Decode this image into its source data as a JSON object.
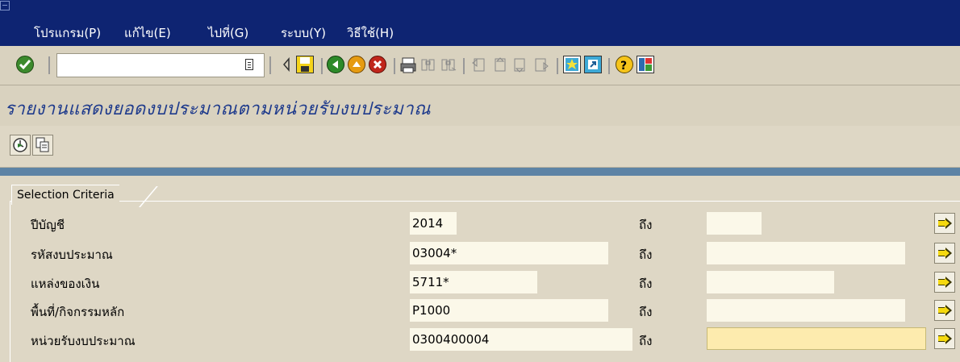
{
  "menu": {
    "items": [
      {
        "label": "โปรแกรม(P)"
      },
      {
        "label": "แก้ไข(E)"
      },
      {
        "label": "ไปที่(G)"
      },
      {
        "label": "ระบบ(Y)"
      },
      {
        "label": "วิธีใช้(H)"
      }
    ]
  },
  "toolbar": {
    "command_field_value": "",
    "icons": [
      "enter-check-icon",
      "back-triangle-icon",
      "save-icon",
      "back-icon",
      "exit-icon",
      "cancel-icon",
      "print-icon",
      "find-icon",
      "find-next-icon",
      "first-page-icon",
      "previous-page-icon",
      "next-page-icon",
      "last-page-icon",
      "create-session-icon",
      "create-shortcut-icon",
      "help-icon",
      "customize-layout-icon"
    ]
  },
  "page": {
    "title": "รายงานแสดงยอดงบประมาณตามหน่วยรับงบประมาณ"
  },
  "app_toolbar": {
    "icons": [
      "execute-icon",
      "get-variant-icon"
    ]
  },
  "selection": {
    "section_title": "Selection Criteria",
    "to_label": "ถึง",
    "rows": [
      {
        "label": "ปีบัญชี",
        "from": "2014",
        "to": ""
      },
      {
        "label": "รหัสงบประมาณ",
        "from": "03004*",
        "to": ""
      },
      {
        "label": "แหล่งของเงิน",
        "from": "5711*",
        "to": ""
      },
      {
        "label": "พื้นที่/กิจกรรมหลัก",
        "from": "P1000",
        "to": ""
      },
      {
        "label": "หน่วยรับงบประมาณ",
        "from": "0300400004",
        "to": ""
      }
    ]
  },
  "colors": {
    "menubar": "#0e2472",
    "background": "#ded7c5",
    "title_text": "#1f3b8c",
    "active_field": "#fdebae",
    "blue_strip": "#5d83a5"
  }
}
